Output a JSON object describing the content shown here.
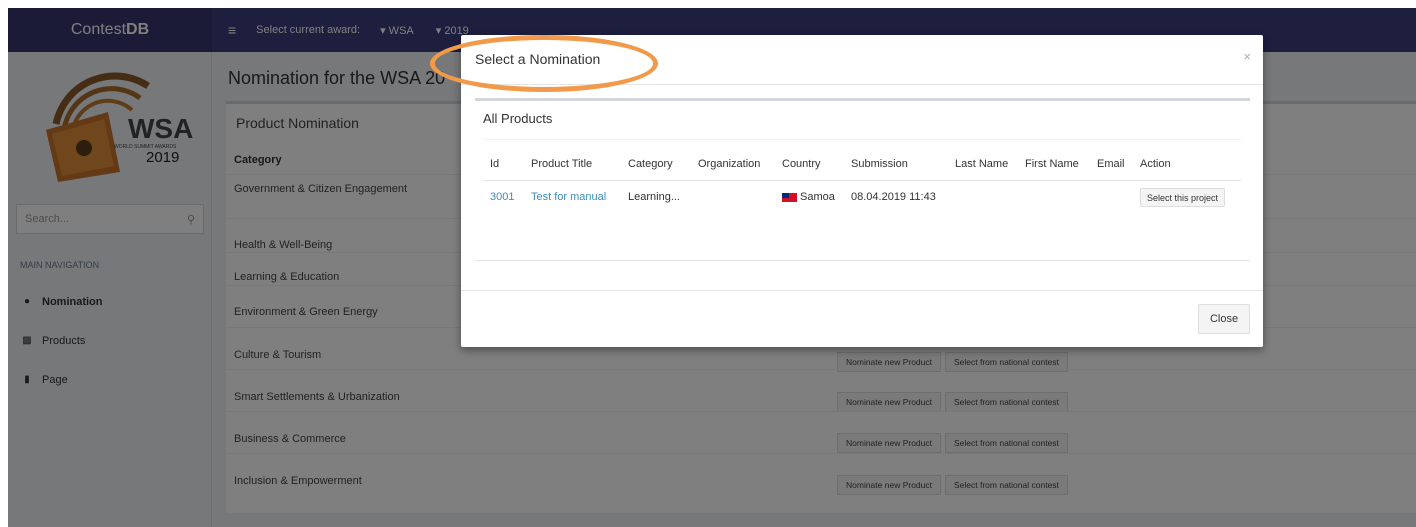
{
  "app": {
    "logo_prefix": "Contest",
    "logo_bold": "DB"
  },
  "header": {
    "award_label": "Select current award:",
    "award_value": "▾ WSA",
    "year_value": "▾ 2019"
  },
  "brand": {
    "logo_text": "WSA",
    "logo_subtext": "WORLD SUMMIT AWARDS",
    "logo_year": "2019"
  },
  "sidebar": {
    "search_placeholder": "Search...",
    "nav_header": "MAIN NAVIGATION",
    "items": [
      {
        "label": "Nomination",
        "icon": "circle-icon"
      },
      {
        "label": "Products",
        "icon": "sitemap-icon"
      },
      {
        "label": "Page",
        "icon": "file-icon"
      }
    ]
  },
  "main": {
    "title": "Nomination for the WSA 20",
    "panel_title": "Product Nomination",
    "column_header": "Category",
    "categories": [
      "Government & Citizen Engagement",
      "Health & Well-Being",
      "Learning & Education",
      "Environment & Green Energy",
      "Culture & Tourism",
      "Smart Settlements & Urbanization",
      "Business & Commerce",
      "Inclusion & Empowerment"
    ],
    "btn_nominate": "Nominate new Product",
    "btn_select": "Select from national contest"
  },
  "modal": {
    "title": "Select a Nomination",
    "close_x": "×",
    "box_title": "All Products",
    "headers": [
      "Id",
      "Product Title",
      "Category",
      "Organization",
      "Country",
      "Submission",
      "Last Name",
      "First Name",
      "Email",
      "Action"
    ],
    "row": {
      "id": "3001",
      "title": "Test for manual",
      "category": "Learning...",
      "organization": "",
      "country": "Samoa",
      "submission": "08.04.2019 11:43",
      "last_name": "",
      "first_name": "",
      "email": "",
      "action": "Select this project"
    },
    "close_label": "Close"
  },
  "colors": {
    "header": "#3c3c7f",
    "accent": "#3c8dbc",
    "highlight": "#f09a4a"
  }
}
